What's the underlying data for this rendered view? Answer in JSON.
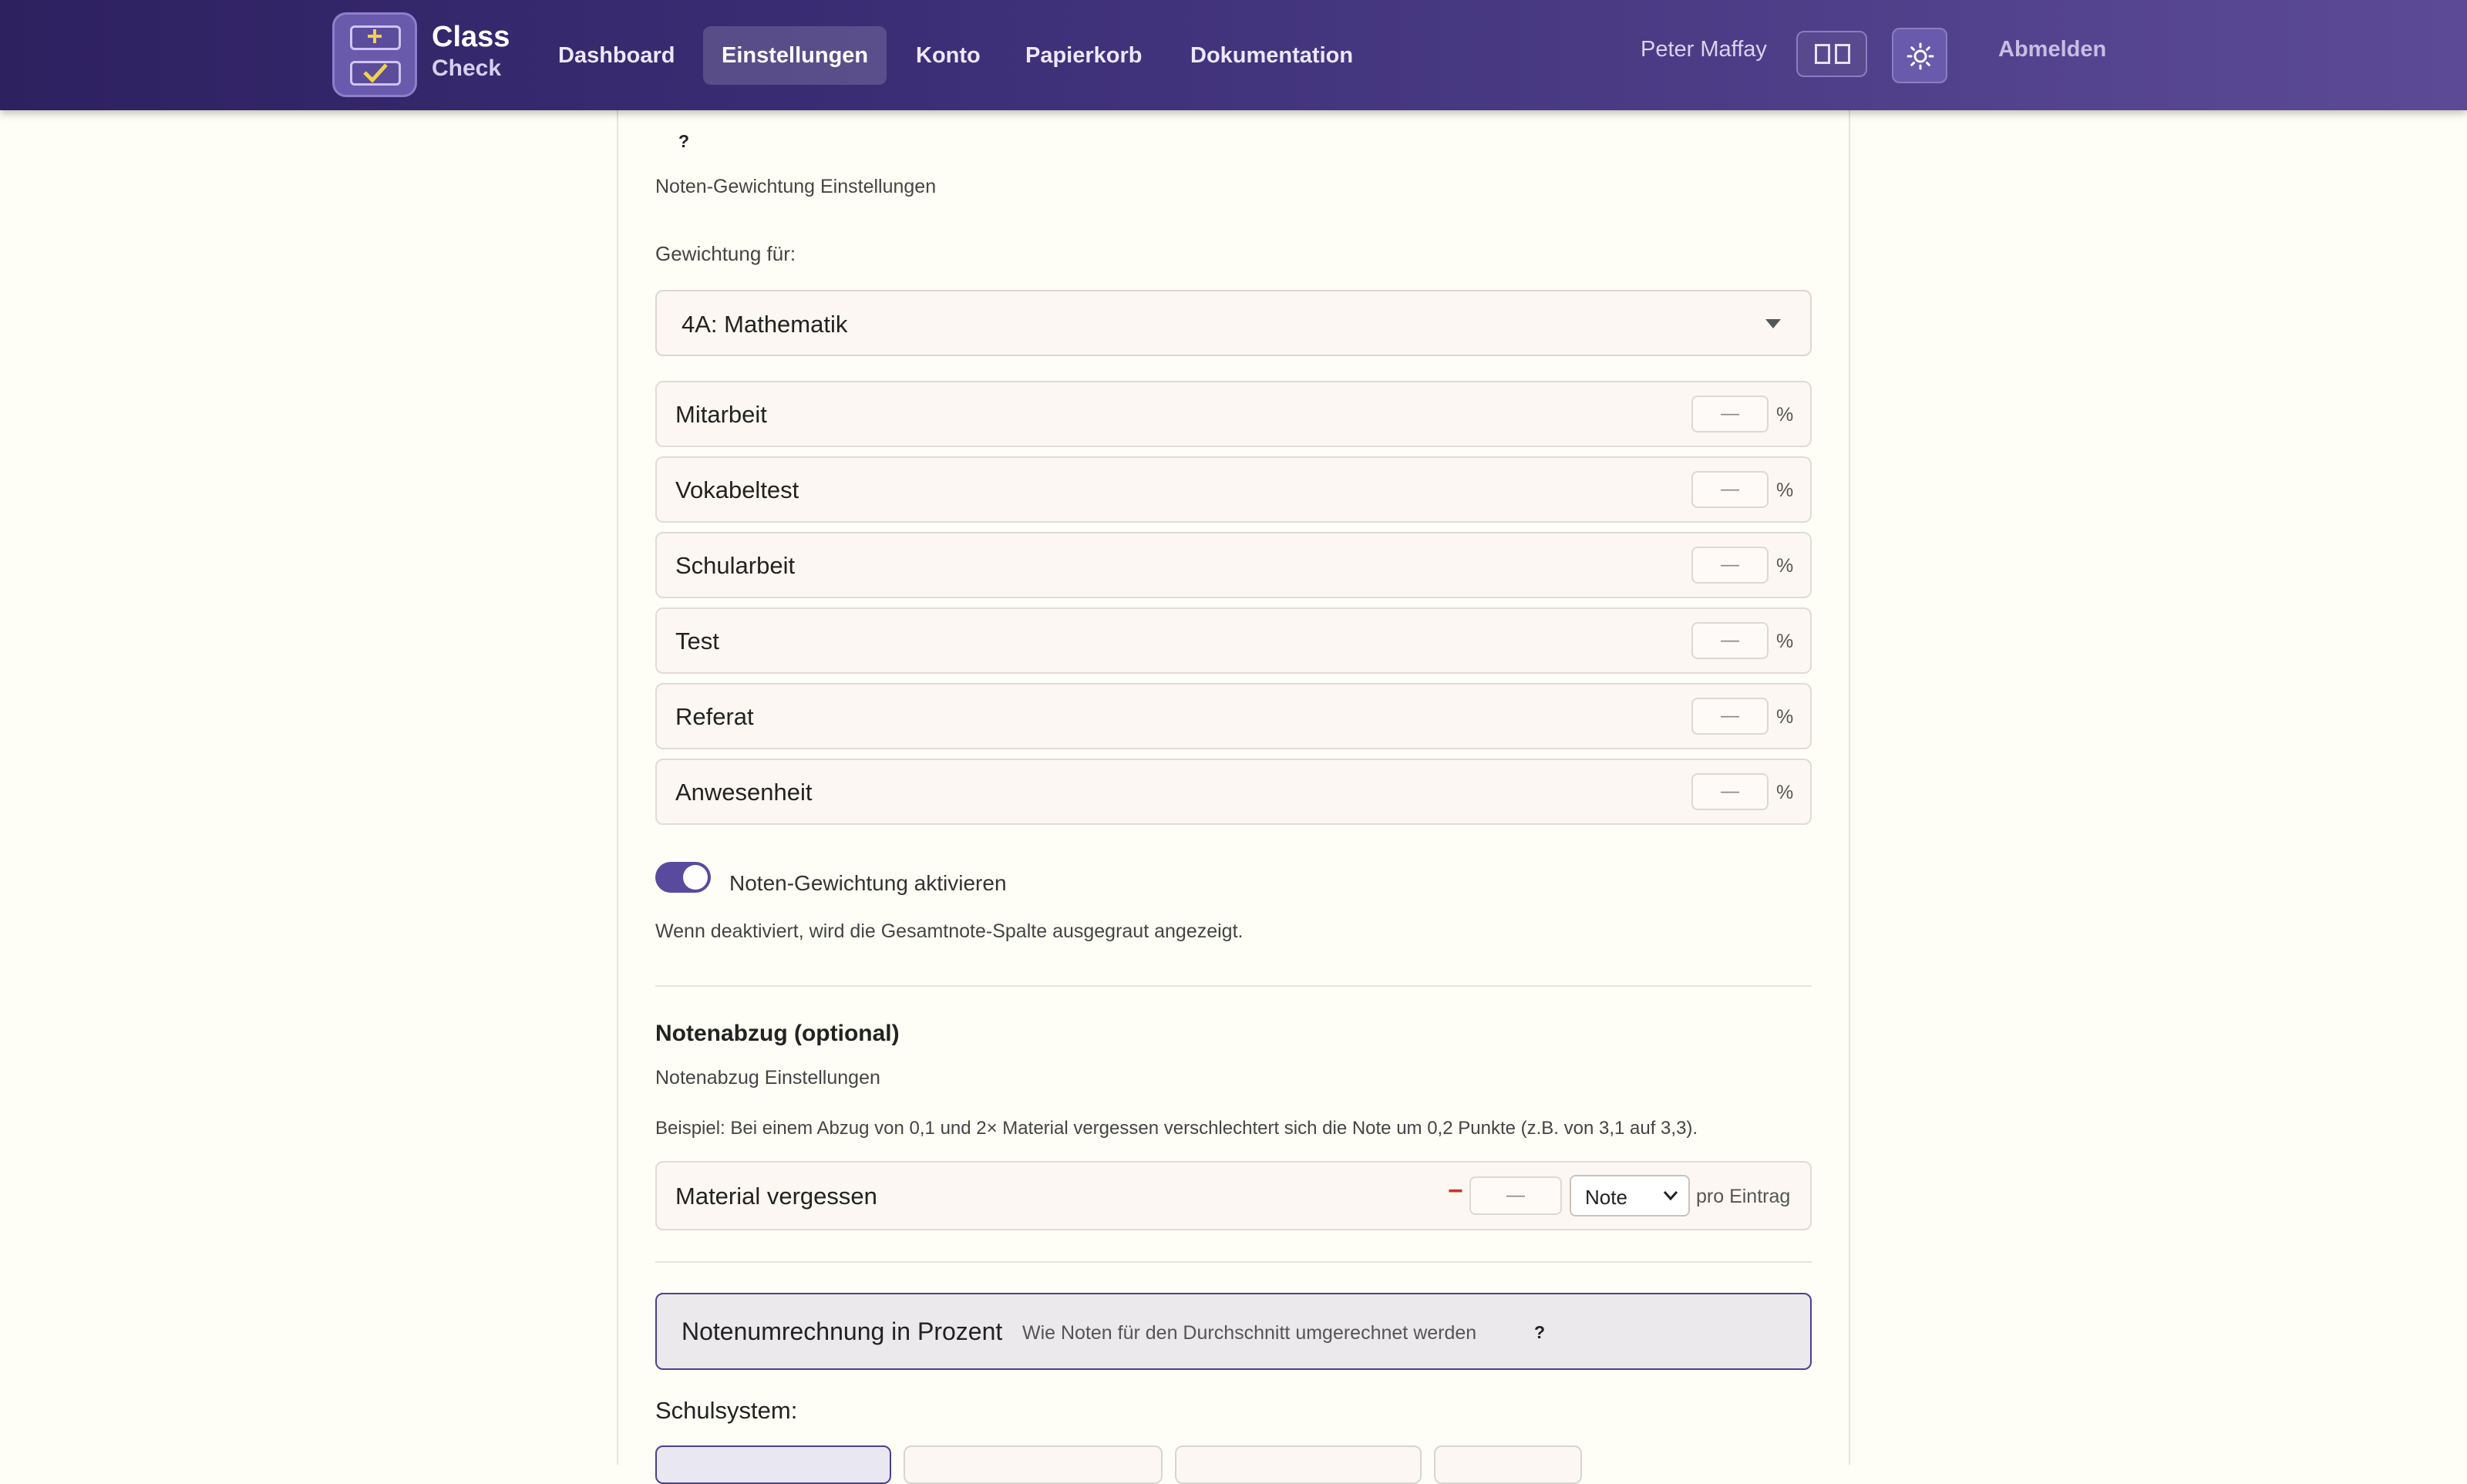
{
  "header": {
    "logo_title": "Class",
    "logo_subtitle": "Check",
    "nav": [
      {
        "label": "Dashboard"
      },
      {
        "label": "Einstellungen",
        "active": true
      },
      {
        "label": "Konto"
      },
      {
        "label": "Papierkorb"
      },
      {
        "label": "Dokumentation"
      }
    ],
    "user_name": "Peter Maffay",
    "logout_label": "Abmelden",
    "icons": {
      "logo": "calculator-check-icon",
      "layout": "columns-layout-icon",
      "theme": "sun-icon"
    }
  },
  "weighting": {
    "help": "?",
    "subtitle": "Noten-Gewichtung Einstellungen",
    "for_label": "Gewichtung für:",
    "selected_class": "4A: Mathematik",
    "categories": [
      {
        "name": "Mitarbeit",
        "value": "—"
      },
      {
        "name": "Vokabeltest",
        "value": "—"
      },
      {
        "name": "Schularbeit",
        "value": "—"
      },
      {
        "name": "Test",
        "value": "—"
      },
      {
        "name": "Referat",
        "value": "—"
      },
      {
        "name": "Anwesenheit",
        "value": "—"
      }
    ],
    "percent_sign": "%",
    "toggle_label": "Noten-Gewichtung aktivieren",
    "toggle_on": true,
    "toggle_hint": "Wenn deaktiviert, wird die Gesamtnote-Spalte ausgegraut angezeigt."
  },
  "deduction": {
    "title": "Notenabzug (optional)",
    "subtitle": "Notenabzug Einstellungen",
    "example": "Beispiel: Bei einem Abzug von 0,1 und 2× Material vergessen verschlechtert sich die Note um 0,2 Punkte (z.B. von 3,1 auf 3,3).",
    "row": {
      "name": "Material vergessen",
      "minus": "−",
      "value": "—",
      "unit_selected": "Note",
      "suffix": "pro Eintrag"
    }
  },
  "conversion": {
    "title": "Notenumrechnung in Prozent",
    "description": "Wie Noten für den Durchschnitt umgerechnet werden",
    "help": "?",
    "school_system_label": "Schulsystem:"
  },
  "colors": {
    "accent": "#4f408f",
    "header_start": "#2e2160",
    "header_end": "#5c4a96",
    "deduct_red": "#c0392b"
  }
}
